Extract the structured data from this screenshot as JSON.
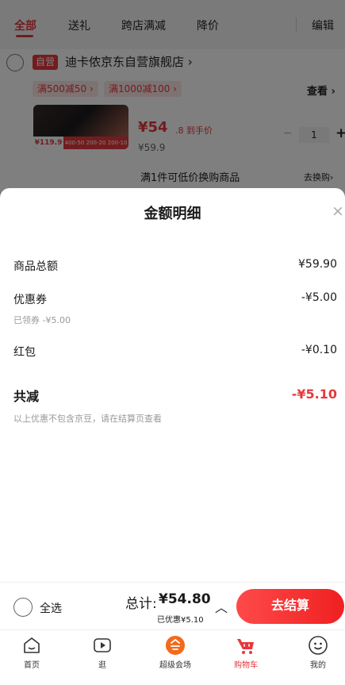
{
  "filter_tabs": [
    "全部",
    "送礼",
    "跨店满减",
    "降价"
  ],
  "edit_label": "编辑",
  "store": {
    "badge": "自营",
    "name": "迪卡侬京东自营旗舰店",
    "arrow": "›",
    "promos": [
      "满500减50 ›",
      "满1000减100 ›"
    ],
    "view_label": "查看 ›"
  },
  "product": {
    "thumb_price": "¥119.9",
    "thumb_strip": "400-50 200-20 200-10",
    "price_main": "¥54",
    "price_sub": ".8 到手价",
    "original_price": "¥59.9",
    "qty_minus": "−",
    "qty": "1",
    "qty_plus": "+"
  },
  "exchange": {
    "label": "满1件可低价换购商品",
    "action": "去换购›"
  },
  "sheet": {
    "title": "金额明细",
    "close": "×",
    "goods_total_label": "商品总额",
    "goods_total_value": "¥59.90",
    "coupon_label": "优惠券",
    "coupon_value": "-¥5.00",
    "coupon_note": "已领券 -¥5.00",
    "redpacket_label": "红包",
    "redpacket_value": "-¥0.10",
    "total_reduce_label": "共减",
    "total_reduce_value": "-¥5.10",
    "disclaimer": "以上优惠不包含京豆，请在结算页查看"
  },
  "checkout": {
    "select_all": "全选",
    "total_prefix": "总计:",
    "total_value": "¥54.80",
    "discount_note": "已优惠¥5.10",
    "chevron": "︿",
    "button": "去结算"
  },
  "tabs": [
    {
      "label": "首页",
      "icon": "home-icon"
    },
    {
      "label": "逛",
      "icon": "video-icon"
    },
    {
      "label": "超级会场",
      "icon": "venue-icon"
    },
    {
      "label": "购物车",
      "icon": "cart-icon"
    },
    {
      "label": "我的",
      "icon": "profile-icon"
    }
  ],
  "colors": {
    "accent": "#e4393c",
    "overlay": "rgba(0,0,0,0.5)"
  }
}
